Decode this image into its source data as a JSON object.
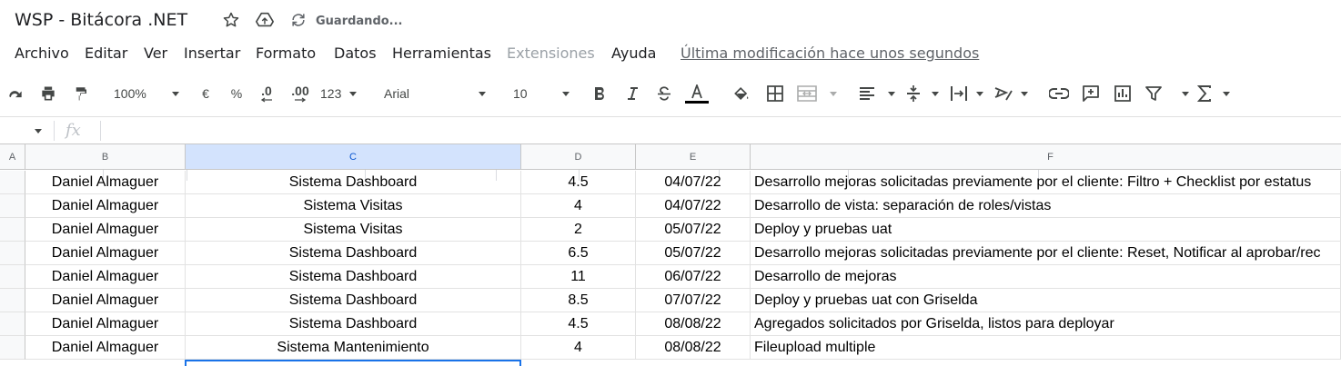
{
  "doc": {
    "title": "WSP - Bitácora .NET",
    "save_status": "Guardando..."
  },
  "menu": {
    "items": [
      "Archivo",
      "Editar",
      "Ver",
      "Insertar",
      "Formato",
      "Datos",
      "Herramientas",
      "Extensiones",
      "Ayuda"
    ],
    "last_edit": "Última modificación hace unos segundos"
  },
  "toolbar": {
    "zoom": "100%",
    "currency": "€",
    "percent": "%",
    "dec_decrease": ".0",
    "dec_increase": ".00",
    "more_formats": "123",
    "font": "Arial",
    "font_size": "10"
  },
  "formula": {
    "fx": "fx"
  },
  "columns": [
    "A",
    "B",
    "C",
    "D",
    "E",
    "F"
  ],
  "rows": [
    {
      "b": "Daniel Almaguer",
      "c": "Sistema Dashboard",
      "d": "4.5",
      "e": "04/07/22",
      "f": "Desarrollo mejoras solicitadas previamente por el cliente: Filtro + Checklist por estatus"
    },
    {
      "b": "Daniel Almaguer",
      "c": "Sistema Visitas",
      "d": "4",
      "e": "04/07/22",
      "f": "Desarrollo de vista: separación de roles/vistas"
    },
    {
      "b": "Daniel Almaguer",
      "c": "Sistema Visitas",
      "d": "2",
      "e": "05/07/22",
      "f": "Deploy y pruebas uat"
    },
    {
      "b": "Daniel Almaguer",
      "c": "Sistema Dashboard",
      "d": "6.5",
      "e": "05/07/22",
      "f": "Desarrollo mejoras solicitadas previamente por el cliente: Reset, Notificar al aprobar/rec"
    },
    {
      "b": "Daniel Almaguer",
      "c": "Sistema Dashboard",
      "d": "11",
      "e": "06/07/22",
      "f": "Desarrollo de mejoras"
    },
    {
      "b": "Daniel Almaguer",
      "c": "Sistema Dashboard",
      "d": "8.5",
      "e": "07/07/22",
      "f": "Deploy y pruebas uat con Griselda"
    },
    {
      "b": "Daniel Almaguer",
      "c": "Sistema Dashboard",
      "d": "4.5",
      "e": "08/08/22",
      "f": "Agregados solicitados por Griselda, listos para deployar"
    },
    {
      "b": "Daniel Almaguer",
      "c": "Sistema Mantenimiento",
      "d": "4",
      "e": "08/08/22",
      "f": "Fileupload multiple"
    }
  ],
  "colors": {
    "accent": "#1a73e8",
    "header_bg": "#f8f9fa",
    "active_header_bg": "#d3e3fd",
    "text_color_bar": "#000000"
  }
}
